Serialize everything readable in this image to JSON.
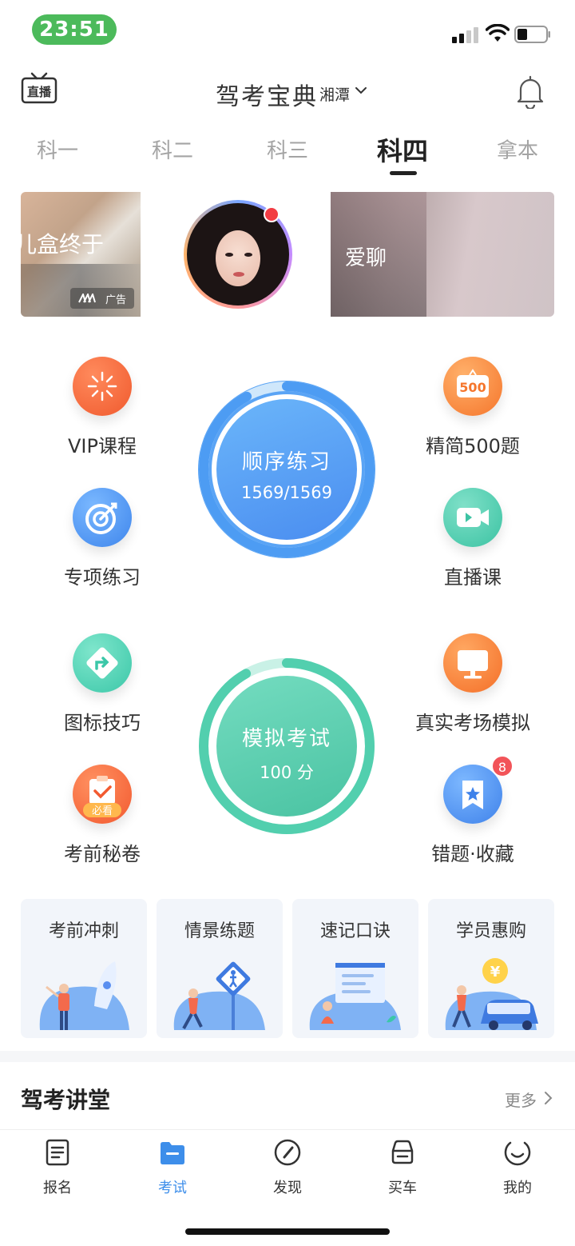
{
  "status": {
    "time": "23:51"
  },
  "header": {
    "live_label": "直播",
    "title": "驾考宝典",
    "city": "湘潭"
  },
  "tabs": [
    {
      "label": "科一",
      "active": false
    },
    {
      "label": "科二",
      "active": false
    },
    {
      "label": "科三",
      "active": false
    },
    {
      "label": "科四",
      "active": true
    },
    {
      "label": "拿本",
      "active": false
    }
  ],
  "banner": {
    "left_text": "儿盒终于",
    "ad_label": "广告",
    "right_text": "爱聊"
  },
  "features": {
    "vip": "VIP课程",
    "jingjian": "精简500题",
    "jingjian_icon_text": "500",
    "zhuanxiang": "专项练习",
    "live_course": "直播课",
    "tubiao": "图标技巧",
    "zhenshi": "真实考场模拟",
    "kaoqian": "考前秘卷",
    "kaoqian_icon_text": "必看",
    "cuoti": "错题·收藏",
    "cuoti_badge": "8"
  },
  "sequence_practice": {
    "title": "顺序练习",
    "progress": "1569/1569",
    "progress_fraction": 1.0
  },
  "mock_exam": {
    "title": "模拟考试",
    "score": "100 分"
  },
  "cards": [
    {
      "title": "考前冲刺"
    },
    {
      "title": "情景练题"
    },
    {
      "title": "速记口诀"
    },
    {
      "title": "学员惠购"
    }
  ],
  "cards_icon_text": "¥",
  "lecture": {
    "title": "驾考讲堂",
    "more": "更多"
  },
  "bottom_nav": [
    {
      "label": "报名",
      "active": false
    },
    {
      "label": "考试",
      "active": true
    },
    {
      "label": "发现",
      "active": false
    },
    {
      "label": "买车",
      "active": false
    },
    {
      "label": "我的",
      "active": false
    }
  ],
  "colors": {
    "accent": "#3d8eea",
    "blue_circle": "#5aa8f5",
    "green_circle": "#5fd4b4",
    "badge": "#f25459"
  }
}
